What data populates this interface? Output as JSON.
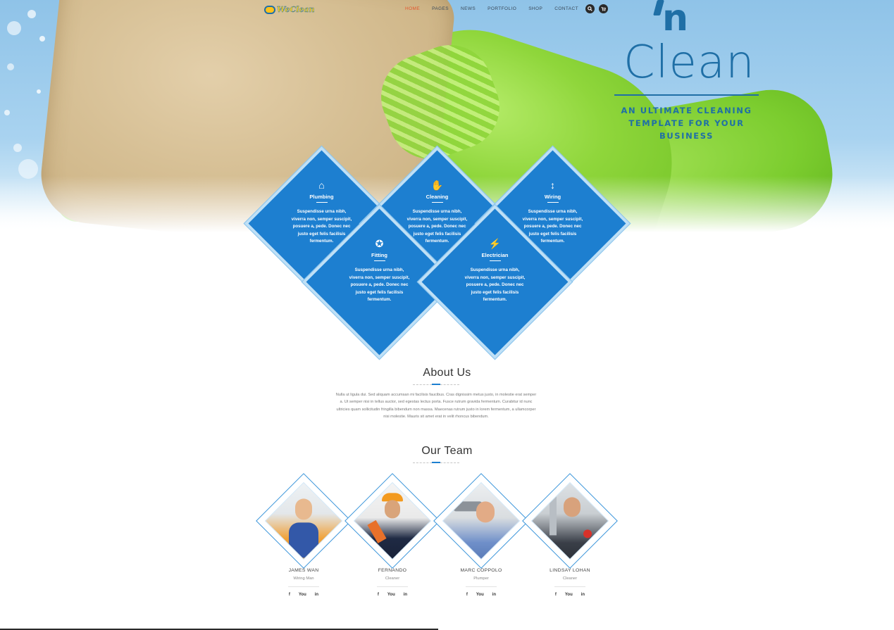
{
  "nav": {
    "logo_text": "WeClean",
    "menu": [
      {
        "label": "HOME",
        "active": true
      },
      {
        "label": "PAGES",
        "active": false
      },
      {
        "label": "NEWS",
        "active": false
      },
      {
        "label": "PORTFOLIO",
        "active": false
      },
      {
        "label": "SHOP",
        "active": false
      },
      {
        "label": "CONTACT",
        "active": false
      }
    ],
    "search_icon": "search-icon",
    "cart_icon": "cart-icon",
    "active_color": "#e4572e"
  },
  "hero": {
    "brand_n": "n",
    "brand_clean": "Clean",
    "tagline_1": "AN ULTIMATE CLEANING",
    "tagline_2": "TEMPLATE FOR YOUR BUSINESS",
    "brand_color": "#1f6fa6"
  },
  "services": [
    {
      "title": "Plumbing",
      "icon": "home-icon",
      "desc": "Suspendisse urna nibh, viverra non, semper suscipit, posuere a, pede. Donec nec justo eget felis facilisis fermentum."
    },
    {
      "title": "Cleaning",
      "icon": "hand-icon",
      "desc": "Suspendisse urna nibh, viverra non, semper suscipit, posuere a, pede. Donec nec justo eget felis facilisis fermentum."
    },
    {
      "title": "Wiring",
      "icon": "arrows-vertical-icon",
      "desc": "Suspendisse urna nibh, viverra non, semper suscipit, posuere a, pede. Donec nec justo eget felis facilisis fermentum."
    },
    {
      "title": "Fitting",
      "icon": "wheel-icon",
      "desc": "Suspendisse urna nibh, viverra non, semper suscipit, posuere a, pede. Donec nec justo eget felis facilisis fermentum."
    },
    {
      "title": "Electrician",
      "icon": "lightning-icon",
      "desc": "Suspendisse urna nibh, viverra non, semper suscipit, posuere a, pede. Donec nec justo eget felis facilisis fermentum."
    }
  ],
  "services_color": "#1d7fd0",
  "about": {
    "title": "About Us",
    "text": "Nulla ut ligula dui. Sed aliquam accumsan mi facilisis faucibus. Cras dignissim metus justo, in molestie erat semper a. Ut semper nisi in tellus auctor, sed egestas lectus porta. Fusce rutrum gravida fermentum. Curabitur id nunc ultricies quam sollicitudin fringilla bibendum non massa. Maecenas rutrum justo in lorem fermentum, a ullamcorper nisi molestie. Mauris sit amet erat in velit rhoncus bibendum."
  },
  "team": {
    "title": "Our Team",
    "members": [
      {
        "name": "JAMES WAN",
        "role": "Wiring Man",
        "social": [
          "f",
          "You",
          "in"
        ]
      },
      {
        "name": "FERNANDO",
        "role": "Cleaner",
        "social": [
          "f",
          "You",
          "in"
        ]
      },
      {
        "name": "MARC COPPOLO",
        "role": "Plumper",
        "social": [
          "f",
          "You",
          "in"
        ]
      },
      {
        "name": "LINDSAY LOHAN",
        "role": "Cleaner",
        "social": [
          "f",
          "You",
          "in"
        ]
      }
    ]
  }
}
